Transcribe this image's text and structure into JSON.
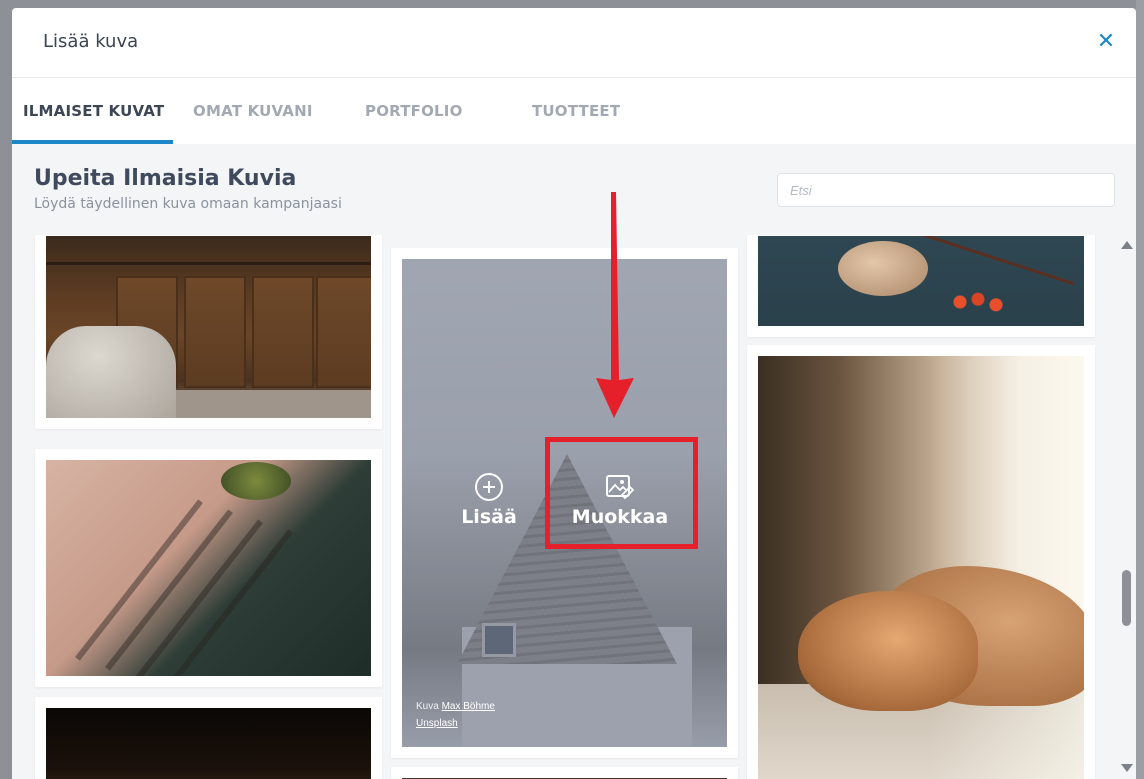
{
  "modal": {
    "title": "Lisää kuva",
    "close_glyph": "✕"
  },
  "tabs": [
    {
      "label": "ILMAISET KUVAT",
      "active": true
    },
    {
      "label": "OMAT KUVANI",
      "active": false
    },
    {
      "label": "PORTFOLIO",
      "active": false
    },
    {
      "label": "TUOTTEET",
      "active": false
    }
  ],
  "section": {
    "title": "Upeita Ilmaisia Kuvia",
    "subtitle": "Löydä täydellinen kuva omaan kampanjaasi"
  },
  "search": {
    "placeholder": "Etsi",
    "value": ""
  },
  "hovered_image": {
    "add_label": "Lisää",
    "edit_label": "Muokkaa",
    "credit_prefix": "Kuva",
    "credit_author": "Max Böhme",
    "credit_source": "Unsplash"
  },
  "icons": {
    "close": "close-icon",
    "add": "plus-circle-icon",
    "edit": "image-edit-icon"
  },
  "colors": {
    "accent": "#1b87c9",
    "highlight": "#e5202a",
    "annotation_arrow": "#e5202a"
  }
}
